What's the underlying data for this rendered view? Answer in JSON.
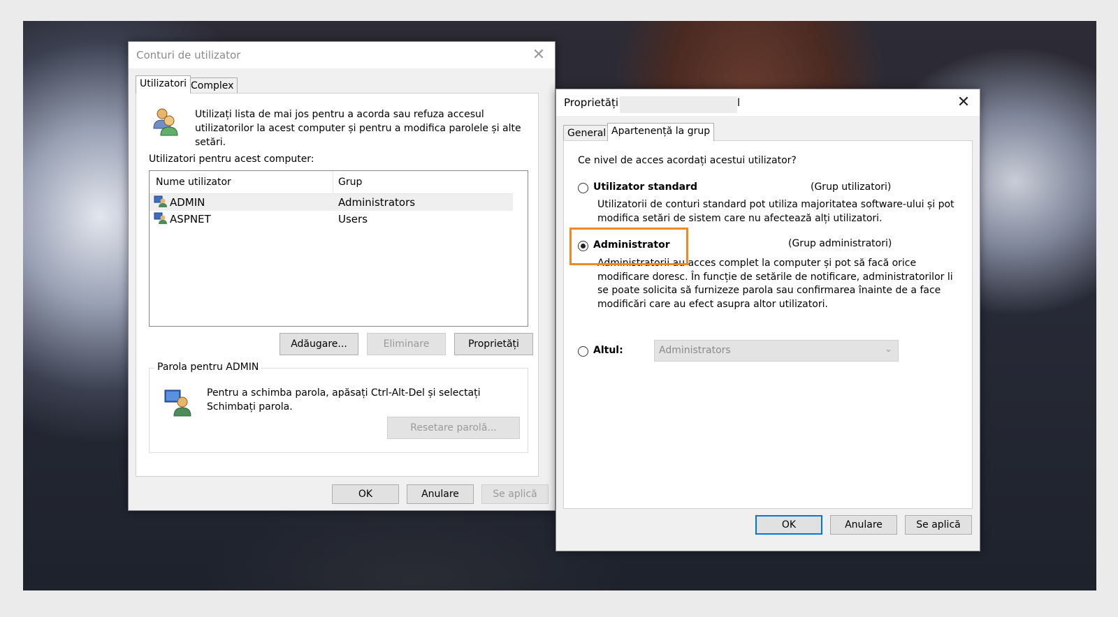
{
  "accounts_window": {
    "title": "Conturi de utilizator",
    "tabs": [
      "Utilizatori",
      "Complex"
    ],
    "intro": [
      "Utilizați lista de mai jos pentru a acorda sau refuza accesul",
      "utilizatorilor la acest computer și pentru a modifica parolele și alte",
      "setări."
    ],
    "users_label": "Utilizatori pentru acest computer:",
    "columns": [
      "Nume utilizator",
      "Grup"
    ],
    "rows": [
      {
        "name": "ADMIN",
        "group": "Administrators"
      },
      {
        "name": "ASPNET",
        "group": "Users"
      }
    ],
    "buttons": {
      "add": "Adăugare...",
      "remove": "Eliminare",
      "properties": "Proprietăți"
    },
    "password_group_label": "Parola pentru ADMIN",
    "password_text": [
      "Pentru a schimba parola, apăsați Ctrl-Alt-Del și selectați",
      "Schimbați parola."
    ],
    "reset_password": "Resetare parolă...",
    "ok": "OK",
    "cancel": "Anulare",
    "apply": "Se aplică"
  },
  "properties_window": {
    "title": "Proprietăți",
    "title_suffix": "l",
    "tabs": [
      "General",
      "Apartenență la grup"
    ],
    "question": "Ce nivel de acces acordați acestui utilizator?",
    "options": {
      "standard": {
        "label": "Utilizator standard",
        "group": "(Grup utilizatori)",
        "desc": [
          "Utilizatorii de conturi standard pot utiliza majoritatea software-ului și pot",
          "modifica setări de sistem care nu afectează alți utilizatori."
        ]
      },
      "admin": {
        "label": "Administrator",
        "group": "(Grup administratori)",
        "desc": [
          "Administratorii au acces complet la computer și pot să facă orice",
          "modificare doresc. În funcție de setările de notificare, administratorilor li",
          "se poate solicita să furnizeze parola sau confirmarea înainte de a face",
          "modificări care au efect asupra altor utilizatori."
        ]
      },
      "other": {
        "label": "Altul:",
        "select_value": "Administrators"
      }
    },
    "selected": "admin",
    "ok": "OK",
    "cancel": "Anulare",
    "apply": "Se aplică"
  },
  "colors": {
    "highlight": "#f0891f",
    "accent": "#0078d7"
  }
}
